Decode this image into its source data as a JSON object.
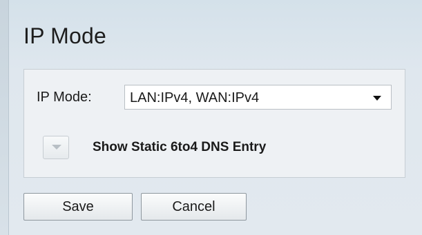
{
  "page": {
    "title": "IP Mode"
  },
  "ip_mode": {
    "label": "IP Mode:",
    "selected_value": "LAN:IPv4, WAN:IPv4"
  },
  "static_6to4": {
    "toggle_label": "Show Static 6to4 DNS Entry",
    "toggle_icon": "chevron-down-icon"
  },
  "actions": {
    "save_label": "Save",
    "cancel_label": "Cancel"
  },
  "colors": {
    "background": "#dfe7ee",
    "panel": "#eef1f4",
    "text": "#1a1a1a"
  }
}
